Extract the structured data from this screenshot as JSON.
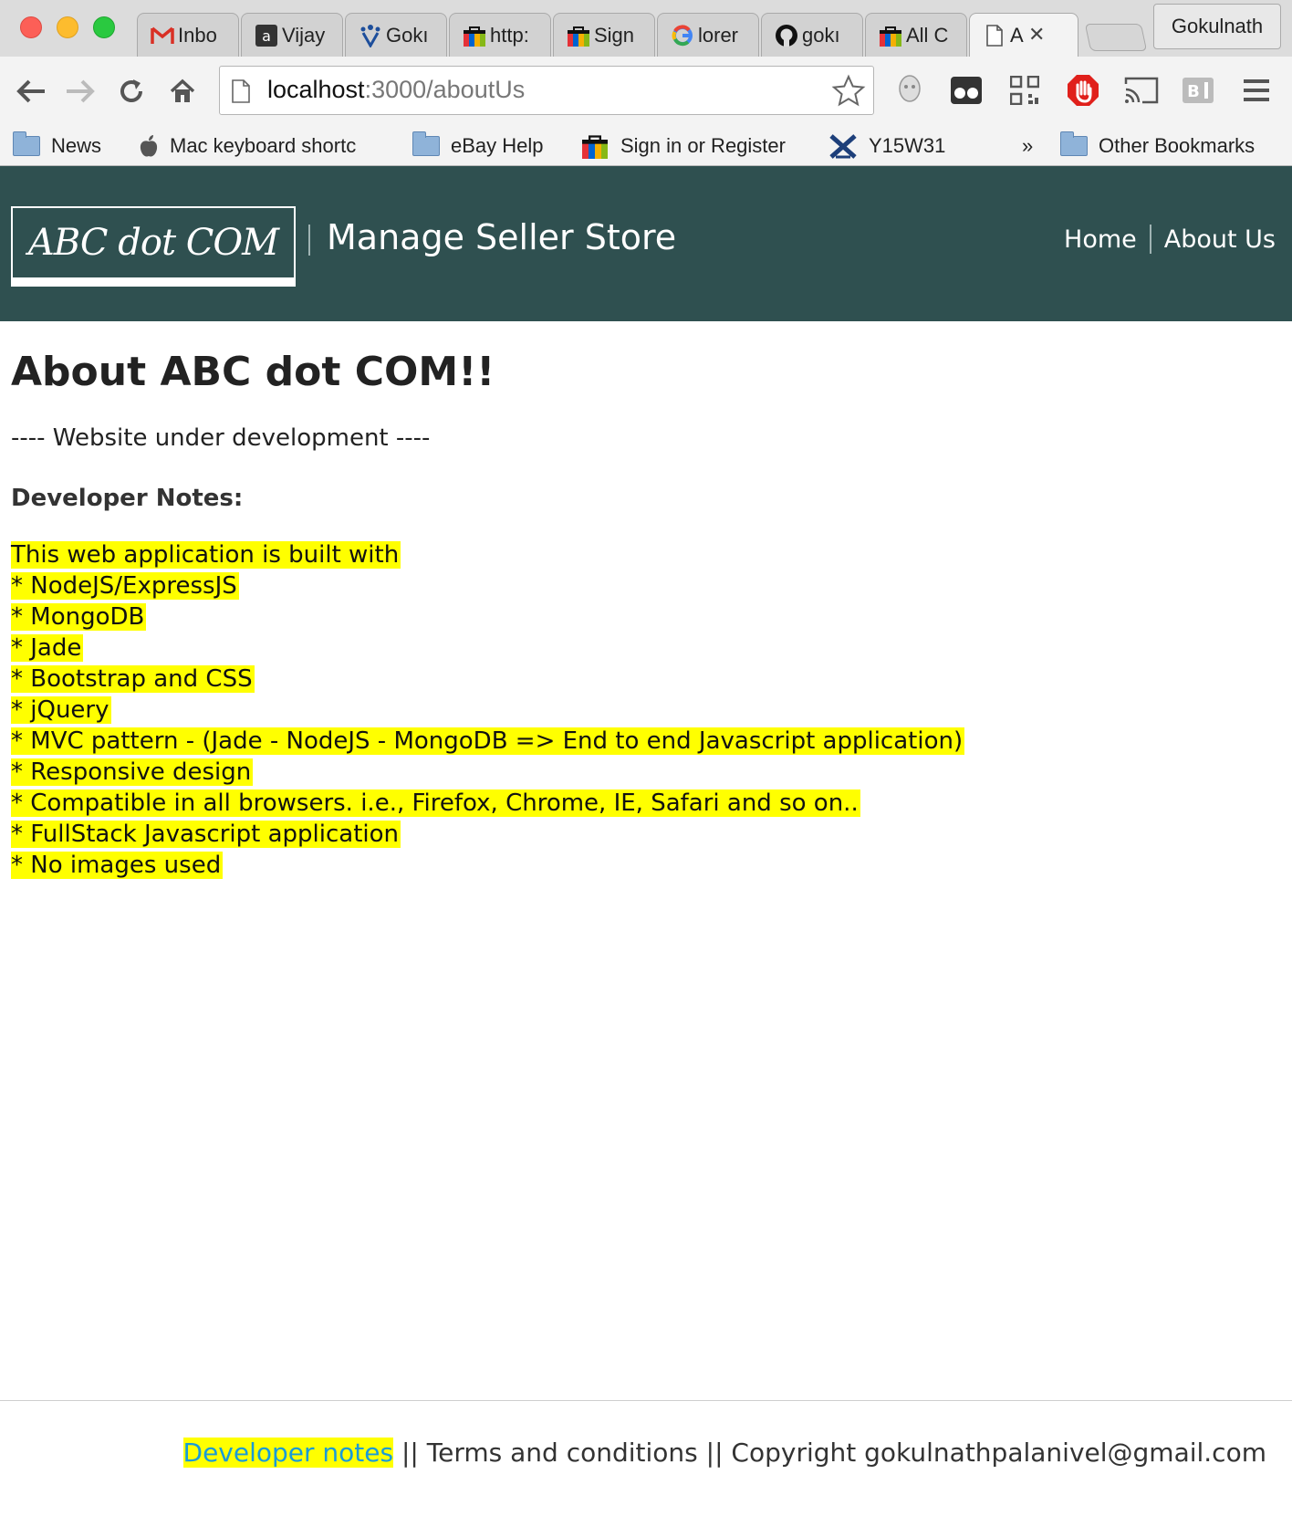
{
  "browser": {
    "tabs": [
      {
        "label": "Inbo",
        "icon": "gmail-icon"
      },
      {
        "label": "Vijay",
        "icon": "amazon-icon"
      },
      {
        "label": "Gokı",
        "icon": "jira-icon"
      },
      {
        "label": "http:",
        "icon": "ebay-bag-icon"
      },
      {
        "label": "Sign",
        "icon": "ebay-bag-icon"
      },
      {
        "label": "lorer",
        "icon": "google-icon"
      },
      {
        "label": "gokı",
        "icon": "github-icon"
      },
      {
        "label": "All C",
        "icon": "ebay-bag-icon"
      },
      {
        "label": "A",
        "icon": "page-icon",
        "active": true
      }
    ],
    "profile_name": "Gokulnath",
    "url_host": "localhost",
    "url_path": ":3000/aboutUs",
    "bookmarks": [
      {
        "label": "News",
        "icon": "folder-icon"
      },
      {
        "label": "Mac keyboard shortc",
        "icon": "apple-icon"
      },
      {
        "label": "eBay Help",
        "icon": "folder-icon"
      },
      {
        "label": "Sign in or Register",
        "icon": "ebay-bag-icon"
      },
      {
        "label": "Y15W31",
        "icon": "x-logo-icon"
      }
    ],
    "bookmarks_overflow": "»",
    "other_bookmarks": "Other Bookmarks"
  },
  "header": {
    "logo": "ABC dot COM",
    "title": "Manage Seller Store",
    "nav": [
      "Home",
      "About Us"
    ]
  },
  "main": {
    "title": "About ABC dot COM!!",
    "subtitle": "---- Website under development ----",
    "notes_heading": "Developer Notes:",
    "notes": [
      "This web application is built with",
      "* NodeJS/ExpressJS",
      "* MongoDB",
      "* Jade",
      "* Bootstrap and CSS",
      "* jQuery",
      "* MVC pattern - (Jade - NodeJS - MongoDB => End to end Javascript application)",
      "* Responsive design",
      "* Compatible in all browsers. i.e., Firefox, Chrome, IE, Safari and so on..",
      "* FullStack Javascript application",
      "* No images used"
    ]
  },
  "footer": {
    "dev_link": "Developer notes",
    "sep": " || ",
    "terms": "Terms and conditions",
    "copyright": "Copyright gokulnathpalanivel@gmail.com"
  },
  "colors": {
    "header_bg": "#2f5050",
    "highlight": "#ffff00",
    "link": "#1a9bd7"
  }
}
